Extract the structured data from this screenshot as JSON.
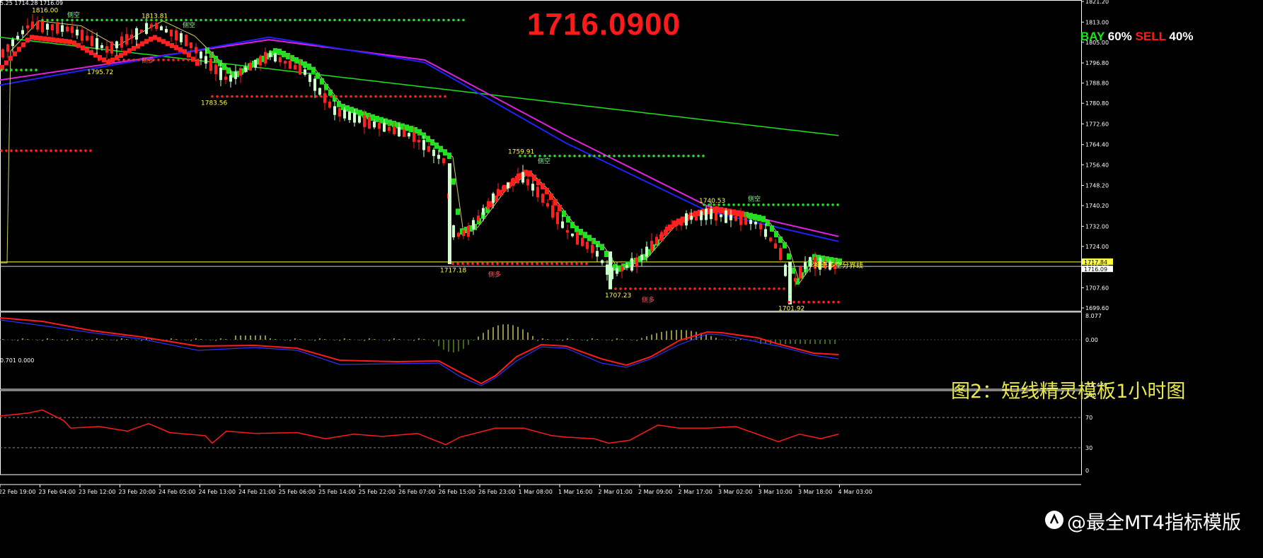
{
  "header": {
    "ohlc_text": "5.25 1714.28 1716.09",
    "current_price": "1716.0900",
    "bay_label": "BAY",
    "bay_pct": "60%",
    "sell_label": "SELL",
    "sell_pct": "40%"
  },
  "caption": "图2：短线精灵模板1小时图",
  "watermark": "@最全MT4指标模版",
  "indicator1_header": "0.701 0.000",
  "colors": {
    "background": "#000000",
    "bull_candle": "#ccffcc",
    "bear_candle": "#ff2020",
    "ma_magenta": "#e020e0",
    "ma_blue": "#2020ff",
    "ma_green": "#20e020",
    "dots_green": "#20e020",
    "dots_red": "#ff2020",
    "label_yellow": "#ffff40"
  },
  "chart_data": [
    {
      "type": "line",
      "title": "",
      "price_axis_ticks": [
        "1821.20",
        "1813.00",
        "1805.00",
        "1796.80",
        "1788.80",
        "1780.80",
        "1772.60",
        "1764.40",
        "1756.40",
        "1748.20",
        "1740.20",
        "1732.00",
        "1724.00",
        "1716.09",
        "1707.60",
        "1699.60"
      ],
      "price_tags": [
        "1717.84",
        "1716.09"
      ],
      "time_axis_labels": [
        "22 Feb 19:00",
        "23 Feb 04:00",
        "23 Feb 12:00",
        "23 Feb 20:00",
        "24 Feb 05:00",
        "24 Feb 13:00",
        "24 Feb 21:00",
        "25 Feb 06:00",
        "25 Feb 14:00",
        "25 Feb 22:00",
        "26 Feb 07:00",
        "26 Feb 15:00",
        "26 Feb 23:00",
        "1 Mar 08:00",
        "1 Mar 16:00",
        "2 Mar 01:00",
        "2 Mar 09:00",
        "2 Mar 17:00",
        "3 Mar 02:00",
        "3 Mar 10:00",
        "3 Mar 18:00",
        "4 Mar 03:00"
      ],
      "swing_labels": [
        {
          "text": "1816.00",
          "price": 1816.0
        },
        {
          "text": "1813.81",
          "price": 1813.81
        },
        {
          "text": "1795.72",
          "price": 1795.72
        },
        {
          "text": "1783.56",
          "price": 1783.56
        },
        {
          "text": "1759.91",
          "price": 1759.91
        },
        {
          "text": "1740.53",
          "price": 1740.53
        },
        {
          "text": "1717.18",
          "price": 1717.18
        },
        {
          "text": "1707.23",
          "price": 1707.23
        },
        {
          "text": "1701.92",
          "price": 1701.92
        }
      ],
      "chinese_marks": {
        "short": "侧空",
        "long": "侧多",
        "boundary": "神奇多空分界线"
      },
      "series": [
        {
          "name": "",
          "values": [
            1790,
            1793,
            1796,
            1799,
            1801,
            1803,
            1804,
            1805,
            1806,
            1806,
            1805,
            1804,
            1802,
            1799,
            1795,
            1790,
            1784,
            1778,
            1771,
            1764,
            1757,
            1750,
            1744,
            1739,
            1735,
            1733,
            1731,
            1729,
            1728,
            1727
          ]
        },
        {
          "name": "",
          "values": [
            1787,
            1792,
            1797,
            1801,
            1804,
            1806,
            1807,
            1806,
            1804,
            1800,
            1795,
            1789,
            1782,
            1775,
            1768,
            1761,
            1755,
            1749,
            1744,
            1740,
            1737,
            1735,
            1733,
            1731,
            1729,
            1727,
            1726,
            1725,
            1724,
            1723
          ]
        },
        {
          "name": "",
          "values": [
            1810,
            1808,
            1806,
            1804,
            1802,
            1800,
            1798,
            1796,
            1794,
            1792,
            1790,
            1788,
            1786,
            1784,
            1782,
            1780,
            1778,
            1776,
            1774,
            1772,
            1770,
            1768
          ]
        }
      ]
    },
    {
      "type": "bar",
      "title": "",
      "axis_ticks": [
        "8.077",
        "0.00",
        "-14.479"
      ],
      "ylim": [
        -14.479,
        8.077
      ]
    },
    {
      "type": "line",
      "title": "",
      "axis_ticks": [
        "100",
        "70",
        "30",
        "0"
      ],
      "ylim": [
        0,
        100
      ]
    }
  ]
}
